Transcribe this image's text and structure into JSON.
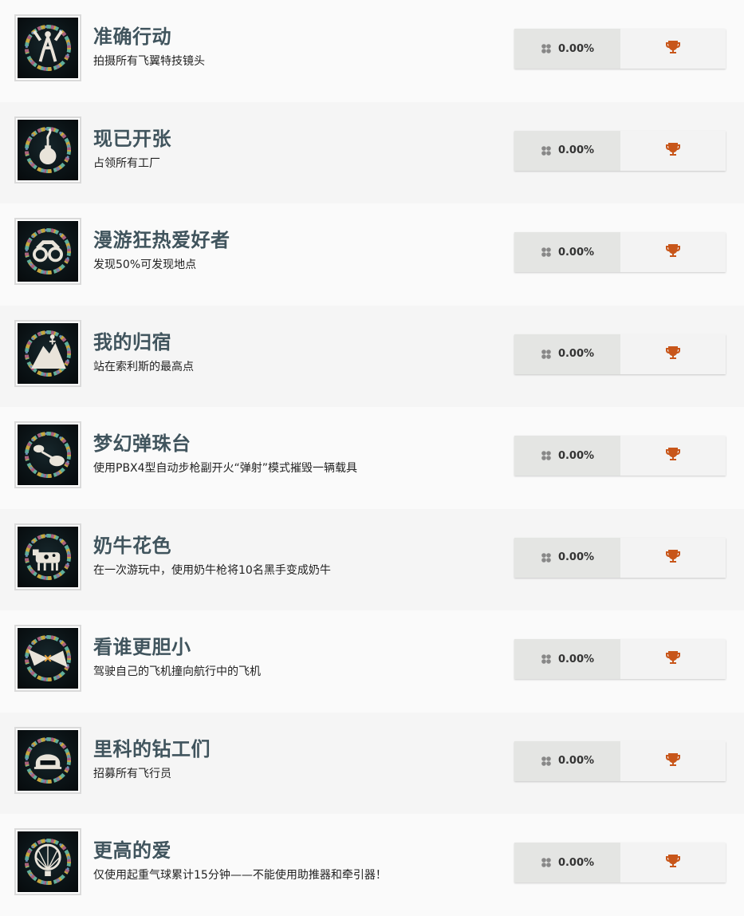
{
  "colors": {
    "title": "#40545d",
    "trophy": "#c8561a",
    "ring": [
      "#5fae9a",
      "#c7a63e",
      "#a9607f",
      "#6a8fb8"
    ]
  },
  "achievements": [
    {
      "title": "准确行动",
      "description": "拍摄所有飞翼特技镜头",
      "percent": "0.00%",
      "icon": "skydiver-icon"
    },
    {
      "title": "现已开张",
      "description": "占领所有工厂",
      "percent": "0.00%",
      "icon": "bomb-icon"
    },
    {
      "title": "漫游狂热爱好者",
      "description": "发现50%可发现地点",
      "percent": "0.00%",
      "icon": "binoculars-icon"
    },
    {
      "title": "我的归宿",
      "description": "站在索利斯的最高点",
      "percent": "0.00%",
      "icon": "mountain-icon"
    },
    {
      "title": "梦幻弹珠台",
      "description": "使用PBX4型自动步枪副开火“弹射”模式摧毁一辆载具",
      "percent": "0.00%",
      "icon": "pinball-icon"
    },
    {
      "title": "奶牛花色",
      "description": "在一次游玩中，使用奶牛枪将10名黑手变成奶牛",
      "percent": "0.00%",
      "icon": "cow-icon"
    },
    {
      "title": "看谁更胆小",
      "description": "驾驶自己的飞机撞向航行中的飞机",
      "percent": "0.00%",
      "icon": "plane-crash-icon"
    },
    {
      "title": "里科的钻工们",
      "description": "招募所有飞行员",
      "percent": "0.00%",
      "icon": "helmet-icon"
    },
    {
      "title": "更高的爱",
      "description": "仅使用起重气球累计15分钟——不能使用助推器和牵引器！",
      "percent": "0.00%",
      "icon": "balloon-icon"
    }
  ]
}
